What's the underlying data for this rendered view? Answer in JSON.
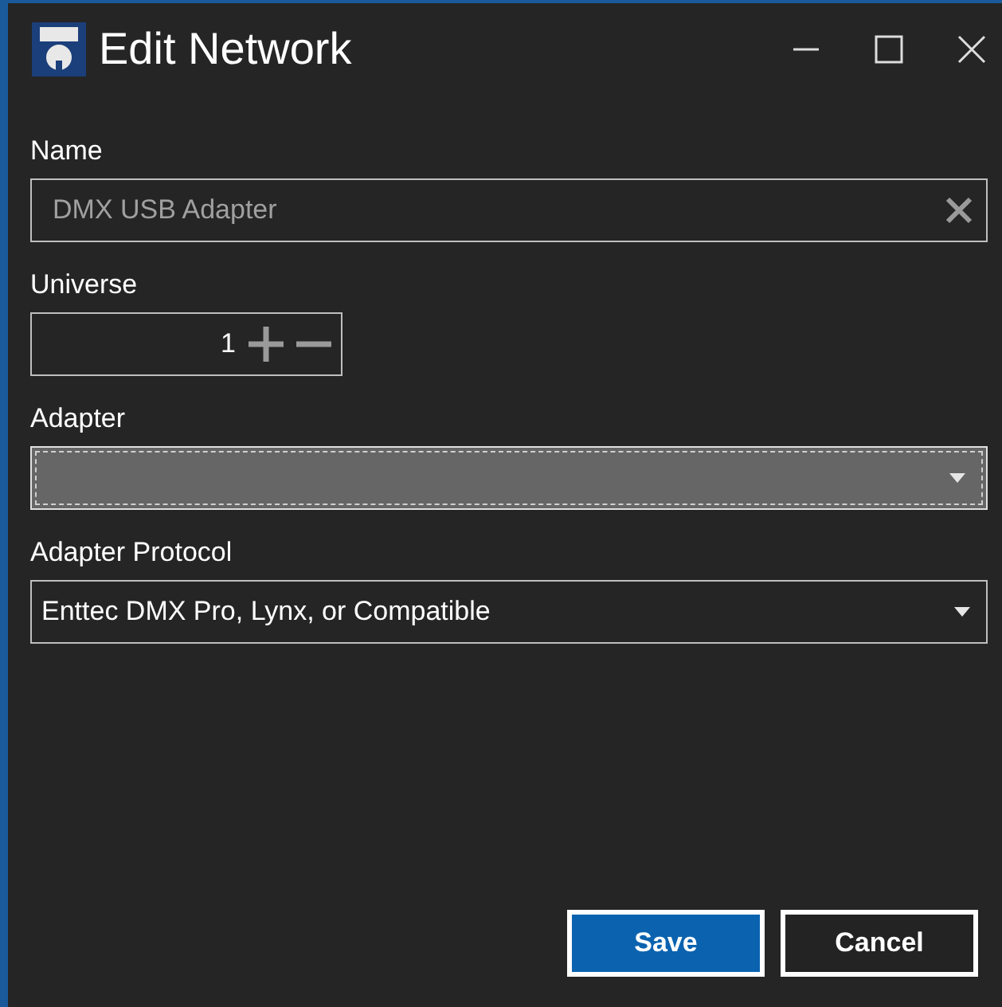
{
  "window": {
    "title": "Edit Network"
  },
  "fields": [
    {
      "kind": "text",
      "label": "Name",
      "value": "DMX USB Adapter"
    },
    {
      "kind": "spinner",
      "label": "Universe",
      "value": "1"
    },
    {
      "kind": "dropdown",
      "label": "Adapter",
      "focused": true
    },
    {
      "kind": "dropdown",
      "label": "Adapter Protocol",
      "value": "Enttec DMX Pro, Lynx, or Compatible",
      "focused": false
    }
  ],
  "buttons": [
    {
      "label": "Save",
      "primary": true
    },
    {
      "label": "Cancel",
      "primary": false
    }
  ]
}
